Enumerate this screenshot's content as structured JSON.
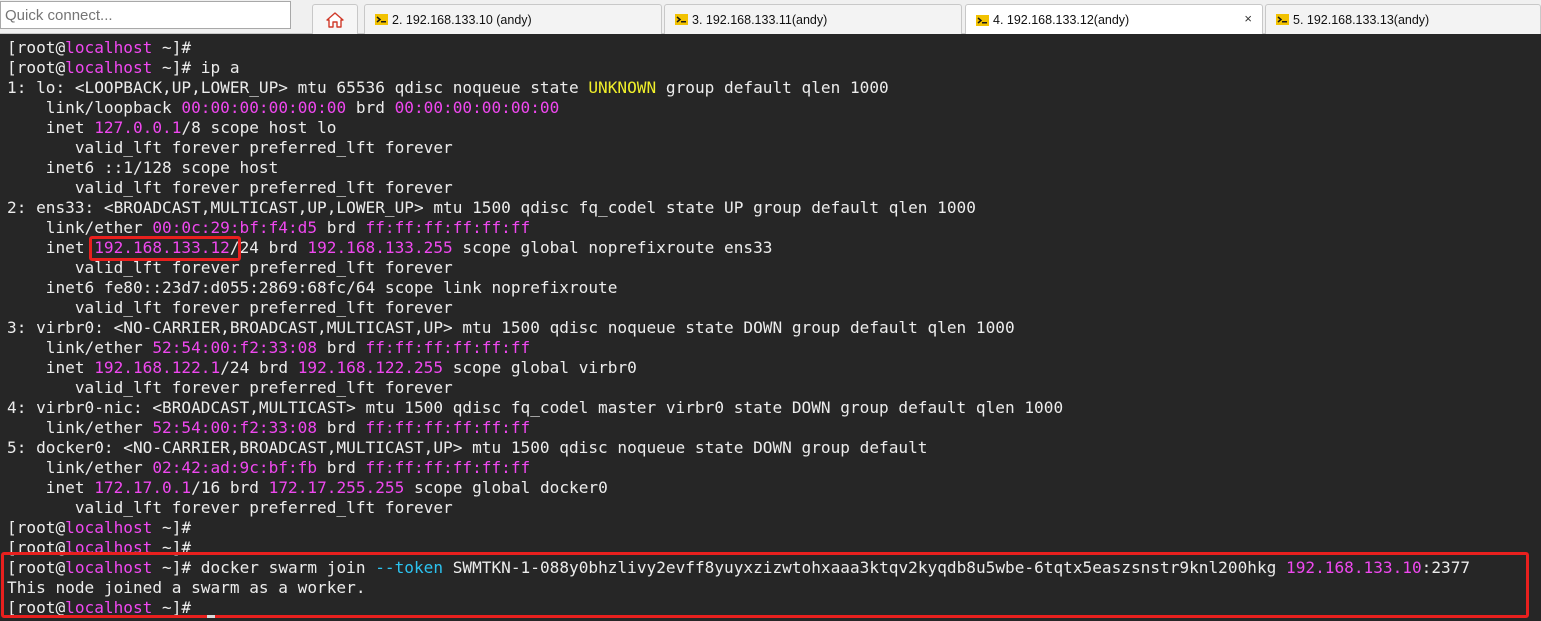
{
  "quick_connect": {
    "placeholder": "Quick connect...",
    "value": ""
  },
  "tabs": [
    {
      "label": "2. 192.168.133.10 (andy)",
      "active": false
    },
    {
      "label": "3. 192.168.133.11(andy)",
      "active": false
    },
    {
      "label": "4. 192.168.133.12(andy)",
      "active": true,
      "close_glyph": "×"
    },
    {
      "label": "5. 192.168.133.13(andy)",
      "active": false
    }
  ],
  "colors": {
    "terminal_bg": "#262626",
    "text": "#ececec",
    "magenta": "#ef48ef",
    "yellow": "#f0ef2a",
    "cyan": "#2cc3f0",
    "highlight_box": "#e8201e"
  },
  "terminal_lines": [
    [
      [
        "[root@"
      ],
      [
        "localhost",
        "mag"
      ],
      [
        " ~]#"
      ]
    ],
    [
      [
        "[root@"
      ],
      [
        "localhost",
        "mag"
      ],
      [
        " ~]# ip a"
      ]
    ],
    [
      [
        "1: lo: <LOOPBACK,UP,LOWER_UP> mtu 65536 qdisc noqueue state "
      ],
      [
        "UNKNOWN",
        "yel"
      ],
      [
        " group default qlen 1000"
      ]
    ],
    [
      [
        "    link/loopback "
      ],
      [
        "00:00:00:00:00:00",
        "mag"
      ],
      [
        " brd "
      ],
      [
        "00:00:00:00:00:00",
        "mag"
      ]
    ],
    [
      [
        "    inet "
      ],
      [
        "127.0.0.1",
        "mag"
      ],
      [
        "/8 scope host lo"
      ]
    ],
    [
      [
        "       valid_lft forever preferred_lft forever"
      ]
    ],
    [
      [
        "    inet6 ::1/128 scope host"
      ]
    ],
    [
      [
        "       valid_lft forever preferred_lft forever"
      ]
    ],
    [
      [
        "2: ens33: <BROADCAST,MULTICAST,UP,LOWER_UP> mtu 1500 qdisc fq_codel state UP group default qlen 1000"
      ]
    ],
    [
      [
        "    link/ether "
      ],
      [
        "00:0c:29:bf:f4:d5",
        "mag"
      ],
      [
        " brd "
      ],
      [
        "ff:ff:ff:ff:ff:ff",
        "mag"
      ]
    ],
    [
      [
        "    inet "
      ],
      [
        "192.168.133.12",
        "mag"
      ],
      [
        "/24 brd "
      ],
      [
        "192.168.133.255",
        "mag"
      ],
      [
        " scope global noprefixroute ens33"
      ]
    ],
    [
      [
        "       valid_lft forever preferred_lft forever"
      ]
    ],
    [
      [
        "    inet6 fe80::23d7:d055:2869:68fc/64 scope link noprefixroute"
      ]
    ],
    [
      [
        "       valid_lft forever preferred_lft forever"
      ]
    ],
    [
      [
        "3: virbr0: <NO-CARRIER,BROADCAST,MULTICAST,UP> mtu 1500 qdisc noqueue state DOWN group default qlen 1000"
      ]
    ],
    [
      [
        "    link/ether "
      ],
      [
        "52:54:00:f2:33:08",
        "mag"
      ],
      [
        " brd "
      ],
      [
        "ff:ff:ff:ff:ff:ff",
        "mag"
      ]
    ],
    [
      [
        "    inet "
      ],
      [
        "192.168.122.1",
        "mag"
      ],
      [
        "/24 brd "
      ],
      [
        "192.168.122.255",
        "mag"
      ],
      [
        " scope global virbr0"
      ]
    ],
    [
      [
        "       valid_lft forever preferred_lft forever"
      ]
    ],
    [
      [
        "4: virbr0-nic: <BROADCAST,MULTICAST> mtu 1500 qdisc fq_codel master virbr0 state DOWN group default qlen 1000"
      ]
    ],
    [
      [
        "    link/ether "
      ],
      [
        "52:54:00:f2:33:08",
        "mag"
      ],
      [
        " brd "
      ],
      [
        "ff:ff:ff:ff:ff:ff",
        "mag"
      ]
    ],
    [
      [
        "5: docker0: <NO-CARRIER,BROADCAST,MULTICAST,UP> mtu 1500 qdisc noqueue state DOWN group default"
      ]
    ],
    [
      [
        "    link/ether "
      ],
      [
        "02:42:ad:9c:bf:fb",
        "mag"
      ],
      [
        " brd "
      ],
      [
        "ff:ff:ff:ff:ff:ff",
        "mag"
      ]
    ],
    [
      [
        "    inet "
      ],
      [
        "172.17.0.1",
        "mag"
      ],
      [
        "/16 brd "
      ],
      [
        "172.17.255.255",
        "mag"
      ],
      [
        " scope global docker0"
      ]
    ],
    [
      [
        "       valid_lft forever preferred_lft forever"
      ]
    ],
    [
      [
        "[root@"
      ],
      [
        "localhost",
        "mag"
      ],
      [
        " ~]#"
      ]
    ],
    [
      [
        "[root@"
      ],
      [
        "localhost",
        "mag"
      ],
      [
        " ~]#"
      ]
    ],
    [
      [
        "[root@"
      ],
      [
        "localhost",
        "mag"
      ],
      [
        " ~]# docker swarm join "
      ],
      [
        "--token",
        "cyan"
      ],
      [
        " SWMTKN-1-088y0bhzlivy2evff8yuyxzizwtohxaaa3ktqv2kyqdb8u5wbe-6tqtx5easzsnstr9knl200hkg "
      ],
      [
        "192.168.133.10",
        "mag"
      ],
      [
        ":2377"
      ]
    ],
    [
      [
        "This node joined a swarm as a worker."
      ]
    ],
    [
      [
        "[root@"
      ],
      [
        "localhost",
        "mag"
      ],
      [
        " ~]#"
      ]
    ]
  ]
}
